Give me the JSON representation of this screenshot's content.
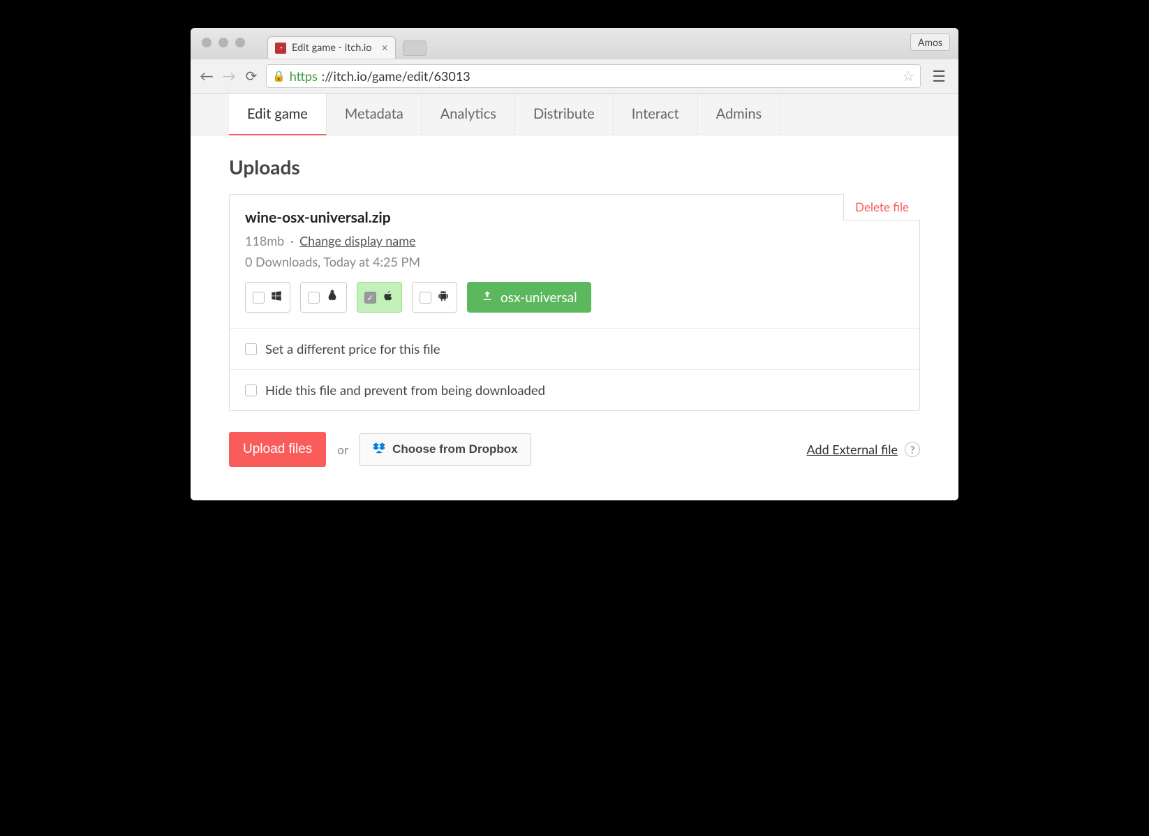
{
  "browser": {
    "tab_title": "Edit game - itch.io",
    "profile_name": "Amos",
    "url_scheme": "https",
    "url_rest": "://itch.io/game/edit/63013"
  },
  "tabs": [
    {
      "label": "Edit game",
      "active": true
    },
    {
      "label": "Metadata",
      "active": false
    },
    {
      "label": "Analytics",
      "active": false
    },
    {
      "label": "Distribute",
      "active": false
    },
    {
      "label": "Interact",
      "active": false
    },
    {
      "label": "Admins",
      "active": false
    }
  ],
  "section_title": "Uploads",
  "upload": {
    "filename": "wine-osx-universal.zip",
    "size": "118mb",
    "change_name_label": "Change display name",
    "stats": "0 Downloads, Today at 4:25 PM",
    "delete_label": "Delete file",
    "platforms": {
      "windows": {
        "checked": false,
        "icon": "windows"
      },
      "linux": {
        "checked": false,
        "icon": "linux"
      },
      "mac": {
        "checked": true,
        "icon": "apple"
      },
      "android": {
        "checked": false,
        "icon": "android"
      }
    },
    "channel_name": "osx-universal",
    "option_price": "Set a different price for this file",
    "option_hide": "Hide this file and prevent from being downloaded"
  },
  "actions": {
    "upload": "Upload files",
    "or": "or",
    "dropbox": "Choose from Dropbox",
    "external": "Add External file",
    "help": "?"
  }
}
